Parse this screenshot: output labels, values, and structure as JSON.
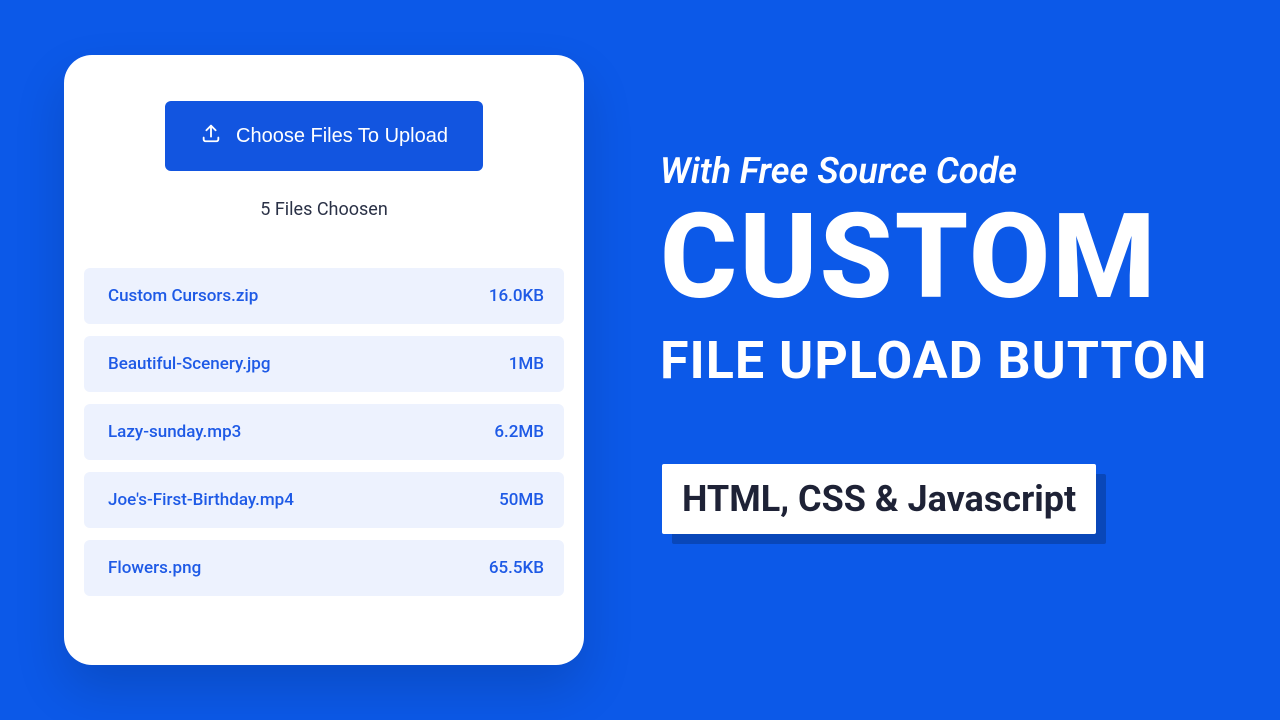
{
  "card": {
    "choose_label": "Choose Files To Upload",
    "choosen_text": "5 Files Choosen",
    "files": [
      {
        "name": "Custom Cursors.zip",
        "size": "16.0KB"
      },
      {
        "name": "Beautiful-Scenery.jpg",
        "size": "1MB"
      },
      {
        "name": "Lazy-sunday.mp3",
        "size": "6.2MB"
      },
      {
        "name": "Joe's-First-Birthday.mp4",
        "size": "50MB"
      },
      {
        "name": "Flowers.png",
        "size": "65.5KB"
      }
    ]
  },
  "headline": {
    "subtitle": "With Free Source Code",
    "title_big": "CUSTOM",
    "title_mid": "FILE UPLOAD BUTTON"
  },
  "tag": {
    "text": "HTML, CSS & Javascript"
  },
  "colors": {
    "bg": "#0c59e8",
    "primary": "#1255e0",
    "file_bg": "#edf2fe",
    "file_text": "#1e5ae6",
    "dark": "#1e2236"
  }
}
